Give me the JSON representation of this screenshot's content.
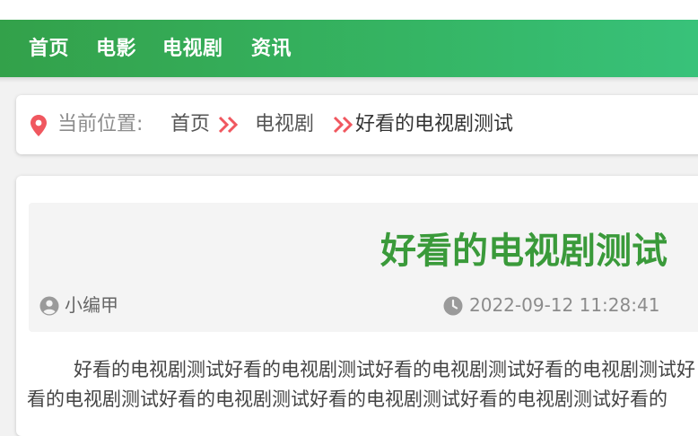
{
  "nav": {
    "items": [
      {
        "label": "首页"
      },
      {
        "label": "电影"
      },
      {
        "label": "电视剧"
      },
      {
        "label": "资讯"
      }
    ]
  },
  "breadcrumb": {
    "label": "当前位置:",
    "home": "首页",
    "category": "电视剧",
    "current": "好看的电视剧测试"
  },
  "article": {
    "title": "好看的电视剧测试",
    "author": "小编甲",
    "datetime": "2022-09-12 11:28:41",
    "body": "好看的电视剧测试好看的电视剧测试好看的电视剧测试好看的电视剧测试好看的电视剧测试好看的电视剧测试好看的电视剧测试好看的电视剧测试好看的"
  },
  "colors": {
    "accent": "#33a14a",
    "title": "#3a9a3a",
    "icon_red": "#f0575f"
  },
  "icons": {
    "location": "location-pin-icon",
    "separator": "double-chevron-right-icon",
    "author": "user-circle-icon",
    "time": "clock-icon"
  }
}
